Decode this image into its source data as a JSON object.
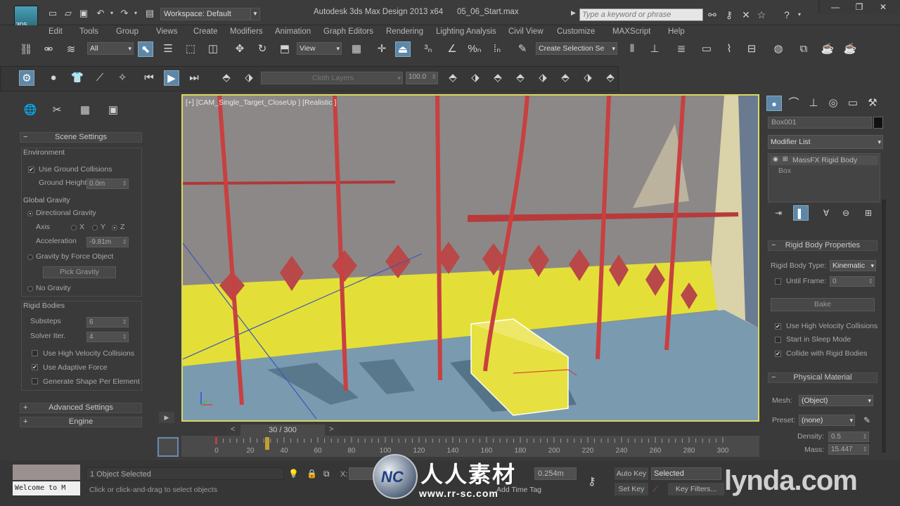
{
  "titlebar": {
    "app_title": "Autodesk 3ds Max Design 2013 x64",
    "file_title": "05_06_Start.max",
    "workspace": "Workspace: Default",
    "search_placeholder": "Type a keyword or phrase",
    "logo": "3DS"
  },
  "menu": [
    "Edit",
    "Tools",
    "Group",
    "Views",
    "Create",
    "Modifiers",
    "Animation",
    "Graph Editors",
    "Rendering",
    "Lighting Analysis",
    "Civil View",
    "Customize",
    "MAXScript",
    "Help"
  ],
  "toolbar": {
    "selection_filter": "All",
    "ref_coord": "View",
    "named_selection": "Create Selection Se",
    "layer_dropdown": "Cloth Layers",
    "layer_value": "100.0"
  },
  "left_panel": {
    "scene_settings": "Scene Settings",
    "environment": "Environment",
    "use_ground_collisions": "Use Ground Collisions",
    "ground_height_label": "Ground Height",
    "ground_height": "0.0m",
    "global_gravity": "Global Gravity",
    "directional_gravity": "Directional Gravity",
    "axis_label": "Axis",
    "axis_x": "X",
    "axis_y": "Y",
    "axis_z": "Z",
    "acceleration_label": "Acceleration",
    "acceleration": "-9.81m",
    "gravity_by_force": "Gravity by Force Object",
    "pick_gravity": "Pick Gravity",
    "no_gravity": "No Gravity",
    "rigid_bodies": "Rigid Bodies",
    "substeps_label": "Substeps",
    "substeps": "6",
    "solver_label": "Solver Iter.",
    "solver": "4",
    "high_velocity": "Use High Velocity Collisions",
    "adaptive_force": "Use Adaptive Force",
    "shape_per_element": "Generate Shape Per Element",
    "advanced_settings": "Advanced Settings",
    "engine": "Engine"
  },
  "viewport": {
    "label": "[+] [CAM_Single_Target_CloseUp ] [Realistic ]"
  },
  "timeline": {
    "frame": "30 / 300",
    "ticks": [
      "0",
      "20",
      "40",
      "60",
      "80",
      "100",
      "120",
      "140",
      "160",
      "180",
      "200",
      "220",
      "240",
      "260",
      "280",
      "300"
    ],
    "progress": 0.1
  },
  "right_panel": {
    "object_name": "Box001",
    "modifier_list": "Modifier List",
    "stack_item1": "MassFX Rigid Body",
    "stack_item2": "Box",
    "rigid_body_properties": "Rigid Body Properties",
    "rigid_body_type_label": "Rigid Body Type:",
    "rigid_body_type": "Kinematic",
    "until_frame": "Until Frame:",
    "until_frame_value": "0",
    "bake": "Bake",
    "use_high_velocity": "Use High Velocity Collisions",
    "start_sleep": "Start in Sleep Mode",
    "collide_rigid": "Collide with Rigid Bodies",
    "physical_material": "Physical Material",
    "mesh_label": "Mesh:",
    "mesh_value": "(Object)",
    "preset_label": "Preset:",
    "preset_value": "(none)",
    "density_label": "Density:",
    "density": "0.5",
    "mass_label": "Mass:",
    "mass": "15.447"
  },
  "status": {
    "listener": "Welcome to M",
    "selected_count": "1 Object Selected",
    "prompt": "Click or click-and-drag to select objects",
    "x_label": "X:",
    "z_value": "0.254m",
    "auto_key": "Auto Key",
    "set_key": "Set Key",
    "selected": "Selected",
    "key_filters": "Key Filters...",
    "time_tag": "Add Time Tag"
  },
  "watermark": {
    "chinese": "人人素材",
    "url": "www.rr-sc.com",
    "lynda": "lynda.com"
  }
}
